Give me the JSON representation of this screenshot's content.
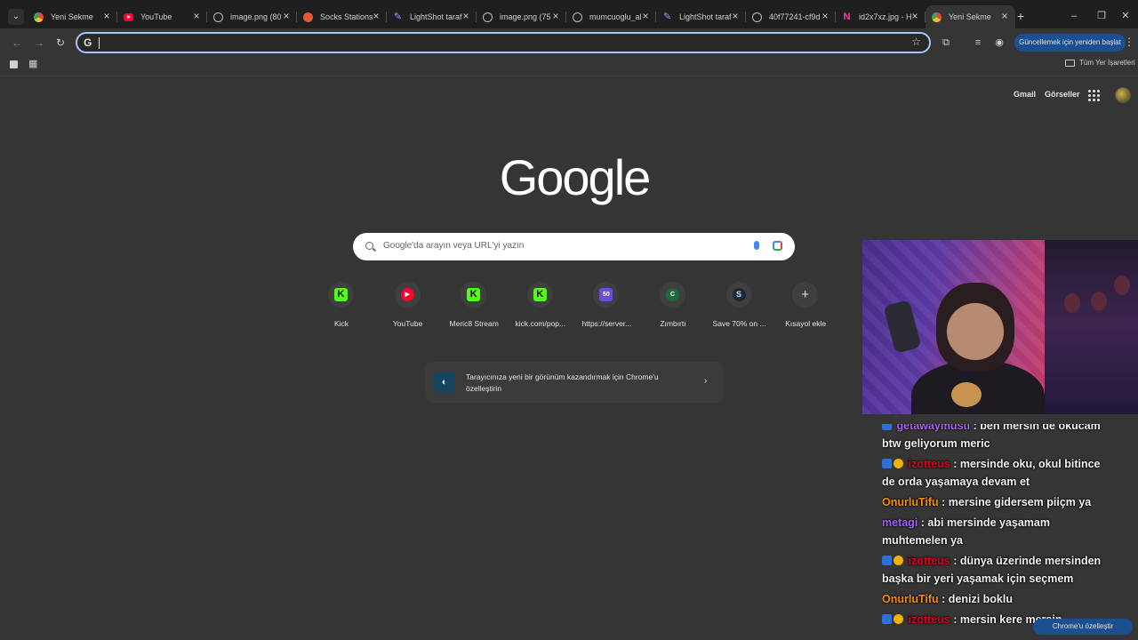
{
  "browser": {
    "tabs": [
      {
        "title": "Yeni Sekme",
        "favicon": "chrome-icon"
      },
      {
        "title": "YouTube",
        "favicon": "youtube-icon"
      },
      {
        "title": "image.png (80",
        "favicon": "globe-icon"
      },
      {
        "title": "Socks Stations",
        "favicon": "socks-icon"
      },
      {
        "title": "LightShot taraf",
        "favicon": "lightshot-icon"
      },
      {
        "title": "image.png (75",
        "favicon": "globe-icon"
      },
      {
        "title": "mumcuoglu_al",
        "favicon": "globe-icon"
      },
      {
        "title": "LightShot taraf",
        "favicon": "lightshot-icon"
      },
      {
        "title": "40f77241-cf9d",
        "favicon": "globe-icon"
      },
      {
        "title": "id2x7xz.jpg - H",
        "favicon": "n-icon"
      },
      {
        "title": "Yeni Sekme",
        "favicon": "chrome-icon",
        "active": true
      }
    ],
    "omnibox": {
      "value": "",
      "placeholder": ""
    },
    "update_button": "Güncellemek için yeniden başlat",
    "bookmarks": {
      "all_bookmarks": "Tüm Yer İşaretleri"
    }
  },
  "ntp": {
    "top_links": {
      "gmail": "Gmail",
      "images": "Görseller"
    },
    "logo": "Google",
    "search_placeholder": "Google'da arayın veya URL'yi yazın",
    "shortcuts": [
      {
        "label": "Kick",
        "icon": "K"
      },
      {
        "label": "YouTube",
        "icon": "▶"
      },
      {
        "label": "Meric8 Stream",
        "icon": "K"
      },
      {
        "label": "kick.com/pop...",
        "icon": "K"
      },
      {
        "label": "https://server...",
        "icon": "50"
      },
      {
        "label": "Zımbırtı",
        "icon": "C"
      },
      {
        "label": "Save 70% on ...",
        "icon": "S"
      },
      {
        "label": "Kısayol ekle",
        "icon": "+"
      }
    ],
    "promo": {
      "text": "Tarayıcınıza yeni bir görünüm kazandırmak için Chrome'u özelleştirin"
    },
    "customize_button": "Chrome'u özelleştir"
  },
  "chat": [
    {
      "user": "getawaymusti",
      "message": "ben mersin de okucam btw geliyorum meric"
    },
    {
      "user": "izotteus",
      "message": "mersinde oku, okul bitince de orda yaşamaya devam et"
    },
    {
      "user": "OnurluTifu",
      "message": "mersine gidersem piiçm ya"
    },
    {
      "user": "metagi",
      "message": "abi mersinde yaşamam muhtemelen ya"
    },
    {
      "user": "izotteus",
      "message": "dünya üzerinde mersinden başka bir yeri yaşamak için seçmem"
    },
    {
      "user": "OnurluTifu",
      "message": "denizi boklu"
    },
    {
      "user": "izotteus",
      "message": "mersin kere mersin"
    }
  ]
}
